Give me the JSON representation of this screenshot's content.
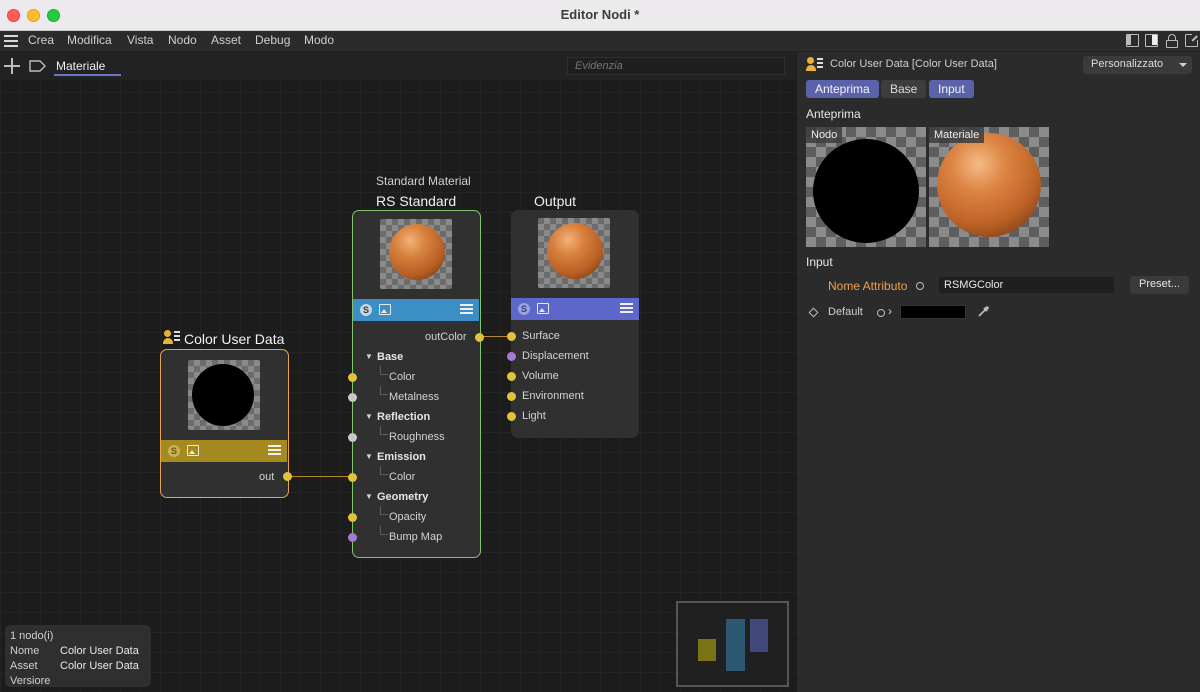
{
  "window": {
    "title": "Editor Nodi *"
  },
  "menu": {
    "items": [
      "Crea",
      "Modifica",
      "Vista",
      "Nodo",
      "Asset",
      "Debug",
      "Modo"
    ]
  },
  "graph": {
    "tab": "Materiale",
    "highlight_placeholder": "Evidenzia",
    "nodes": {
      "color_user_data": {
        "title": "Color User Data",
        "output": "out"
      },
      "rs_standard": {
        "subtitle": "Standard Material",
        "title": "RS Standard",
        "output": "outColor",
        "groups": {
          "base": "Base",
          "base_color": "Color",
          "metalness": "Metalness",
          "reflection": "Reflection",
          "roughness": "Roughness",
          "emission": "Emission",
          "emission_color": "Color",
          "geometry": "Geometry",
          "opacity": "Opacity",
          "bump_map": "Bump Map"
        }
      },
      "output": {
        "title": "Output",
        "inputs": [
          "Surface",
          "Displacement",
          "Volume",
          "Environment",
          "Light"
        ]
      }
    },
    "info": {
      "count": "1 nodo(i)",
      "rows": [
        {
          "label": "Nome",
          "value": "Color User Data"
        },
        {
          "label": "Asset",
          "value": "Color User Data"
        },
        {
          "label": "Versiore",
          "value": ""
        }
      ]
    }
  },
  "panel": {
    "title": "Color User Data [Color User Data]",
    "layout_dropdown": "Personalizzato",
    "tabs": [
      "Anteprima",
      "Base",
      "Input"
    ],
    "preview_section": "Anteprima",
    "preview_labels": [
      "Nodo",
      "Materiale"
    ],
    "input_section": "Input",
    "attribute_label": "Nome Attributo",
    "attribute_value": "RSMGColor",
    "preset_button": "Preset...",
    "default_label": "Default",
    "default_color": "#000000"
  },
  "colors": {
    "accent": "#5b62ac",
    "color_user_node_border": "#e9a34a",
    "rs_node_border": "#7fc36d",
    "rs_bar": "#3b8fc4",
    "output_bar": "#5d67c9",
    "cud_bar": "#a58a1f"
  }
}
